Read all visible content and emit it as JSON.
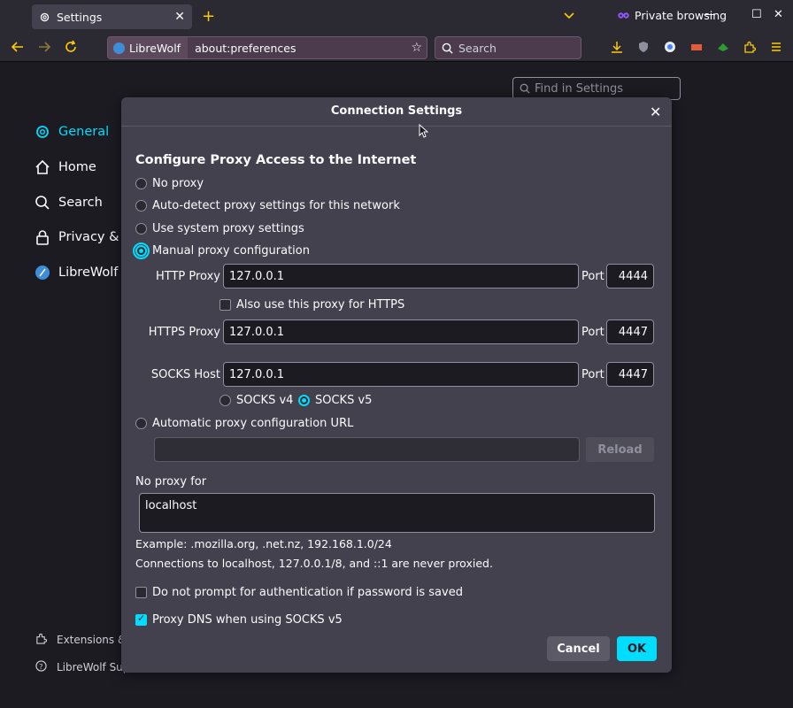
{
  "browser": {
    "tab_title": "Settings",
    "tab_close": "✕",
    "new_tab": "+",
    "private_label": "Private browsing",
    "identity_label": "LibreWolf",
    "url": "about:preferences",
    "search_placeholder": "Search",
    "min": "—",
    "max": "☐",
    "close": "✕",
    "icons": [
      "back-icon",
      "forward-icon",
      "reload-icon",
      "download-icon",
      "ublock-icon",
      "extension-icon",
      "extensions-icon",
      "menu-icon"
    ],
    "accent": "#ffcc00"
  },
  "page": {
    "find_placeholder": "Find in Settings",
    "sidebar": [
      {
        "label": "General",
        "icon": "gear-icon",
        "active": true
      },
      {
        "label": "Home",
        "icon": "home-icon"
      },
      {
        "label": "Search",
        "icon": "search-icon"
      },
      {
        "label": "Privacy & S",
        "icon": "lock-icon"
      },
      {
        "label": "LibreWolf",
        "icon": "librewolf-icon"
      }
    ],
    "footer": [
      {
        "label": "Extensions &",
        "icon": "puzzle-icon"
      },
      {
        "label": "LibreWolf Sup",
        "icon": "help-icon"
      }
    ]
  },
  "dialog": {
    "title": "Connection Settings",
    "close": "✕",
    "heading": "Configure Proxy Access to the Internet",
    "options": {
      "no_proxy": "No proxy",
      "auto_detect": "Auto-detect proxy settings for this network",
      "system": "Use system proxy settings",
      "manual": "Manual proxy configuration",
      "auto_url": "Automatic proxy configuration URL"
    },
    "selected_option": "manual",
    "http_label": "HTTP Proxy",
    "http_value": "127.0.0.1",
    "http_port": "4444",
    "also_https": "Also use this proxy for HTTPS",
    "https_label": "HTTPS Proxy",
    "https_value": "127.0.0.1",
    "https_port": "4447",
    "socks_label": "SOCKS Host",
    "socks_value": "127.0.0.1",
    "socks_port": "4447",
    "port_label": "Port",
    "socks_v4": "SOCKS v4",
    "socks_v5": "SOCKS v5",
    "autoconfig_url": "",
    "reload": "Reload",
    "no_proxy_label": "No proxy for",
    "no_proxy_value": "localhost",
    "example": "Example: .mozilla.org, .net.nz, 192.168.1.0/24",
    "never_proxied": "Connections to localhost, 127.0.0.1/8, and ::1 are never proxied.",
    "no_prompt": "Do not prompt for authentication if password is saved",
    "proxy_dns": "Proxy DNS when using SOCKS v5",
    "cancel": "Cancel",
    "ok": "OK",
    "accent": "#00ddff"
  }
}
